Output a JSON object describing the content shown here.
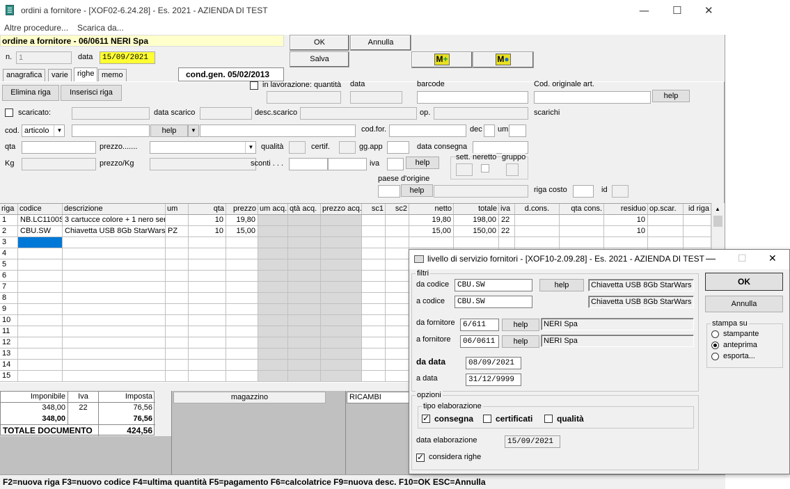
{
  "window": {
    "title": "ordini a fornitore - [XOF02-6.24.28] - Es. 2021 - AZIENDA DI TEST"
  },
  "menu": [
    "Altre procedure...",
    "Scarica da..."
  ],
  "header": {
    "ordine_label": "ordine a fornitore - 06/0611 NERI Spa",
    "n_label": "n.",
    "n_value": "1",
    "data_label": "data",
    "data_value": "15/09/2021",
    "cond_gen": "cond.gen. 05/02/2013"
  },
  "buttons": {
    "ok": "OK",
    "annulla": "Annulla",
    "salva": "Salva",
    "elimina_riga": "Elimina riga",
    "inserisci_riga": "Inserisci riga",
    "help": "help"
  },
  "tabs": [
    "anagrafica",
    "varie",
    "righe",
    "memo"
  ],
  "form": {
    "in_lavorazione": "in lavorazione: quantità",
    "data": "data",
    "barcode": "barcode",
    "cod_originale": "Cod. originale art.",
    "scaricato": "scaricato:",
    "data_scarico": "data scarico",
    "desc_scarico": "desc.scarico",
    "op": "op.",
    "scarichi": "scarichi",
    "cod": "cod.",
    "cod_value": "articolo",
    "cod_for": "cod.for.",
    "dec": "dec",
    "um": "um",
    "qta": "qta",
    "prezzo": "prezzo.......",
    "qualita": "qualità",
    "certif": "certif.",
    "gg_app": "gg.app",
    "data_consegna": "data consegna",
    "kg": "Kg",
    "prezzo_kg": "prezzo/Kg",
    "sconti": "sconti . . .",
    "iva": "iva",
    "sett": "sett.",
    "neretto": "neretto",
    "gruppo": "gruppo",
    "paese_origine": "paese d'origine",
    "riga_costo": "riga costo",
    "id": "id"
  },
  "grid": {
    "headers": [
      "riga",
      "codice",
      "descrizione",
      "um",
      "qta",
      "prezzo",
      "um acq.",
      "qtà acq.",
      "prezzo acq.",
      "sc1",
      "sc2",
      "netto",
      "totale",
      "iva",
      "d.cons.",
      "qta cons.",
      "residuo",
      "op.scar.",
      "id riga"
    ],
    "rows": [
      {
        "riga": "1",
        "codice": "NB.LC1100S",
        "descrizione": "3 cartucce colore + 1 nero ser",
        "um": "",
        "qta": "10",
        "prezzo": "19,80",
        "netto": "19,80",
        "totale": "198,00",
        "iva": "22",
        "residuo": "10"
      },
      {
        "riga": "2",
        "codice": "CBU.SW",
        "descrizione": "Chiavetta USB 8Gb StarWars",
        "um": "PZ",
        "qta": "10",
        "prezzo": "15,00",
        "netto": "15,00",
        "totale": "150,00",
        "iva": "22",
        "residuo": "10"
      }
    ],
    "empty_rows": [
      "3",
      "4",
      "5",
      "6",
      "7",
      "8",
      "9",
      "10",
      "11",
      "12",
      "13",
      "14",
      "15"
    ]
  },
  "totals": {
    "h_imponibile": "Imponibile",
    "h_iva": "Iva",
    "h_imposta": "Imposta",
    "r1_imp": "348,00",
    "r1_iva": "22",
    "r1_imposta": "76,56",
    "r2_imp": "348,00",
    "r2_imposta": "76,56",
    "totale_label": "TOTALE DOCUMENTO",
    "totale_value": "424,56"
  },
  "panels": {
    "magazzino": "magazzino",
    "ricambi": "RICAMBI"
  },
  "status": "F2=nuova riga  F3=nuovo codice  F4=ultima quantità  F5=pagamento  F6=calcolatrice  F9=nuova desc.  F10=OK  ESC=Annulla",
  "dialog": {
    "title": "livello di servizio fornitori - [XOF10-2.09.28] - Es. 2021 - AZIENDA DI TEST",
    "filtri": "filtri",
    "da_codice": "da codice",
    "da_codice_value": "CBU.SW",
    "da_codice_desc": "Chiavetta USB 8Gb StarWars",
    "a_codice": "a codice",
    "a_codice_value": "CBU.SW",
    "a_codice_desc": "Chiavetta USB 8Gb StarWars",
    "da_fornitore": "da fornitore",
    "da_fornitore_value": "6/611",
    "da_fornitore_desc": "NERI Spa",
    "a_fornitore": "a fornitore",
    "a_fornitore_value": "06/0611",
    "a_fornitore_desc": "NERI Spa",
    "da_data": "da data",
    "da_data_value": "08/09/2021",
    "a_data": "a data",
    "a_data_value": "31/12/9999",
    "opzioni": "opzioni",
    "tipo_elaborazione": "tipo elaborazione",
    "consegna": "consegna",
    "certificati": "certificati",
    "qualita": "qualità",
    "data_elaborazione": "data elaborazione",
    "data_elaborazione_value": "15/09/2021",
    "considera_righe": "considera righe",
    "ok": "OK",
    "annulla": "Annulla",
    "help": "help",
    "stampa_su": "stampa su",
    "stampante": "stampante",
    "anteprima": "anteprima",
    "esporta": "esporta..."
  },
  "colors": {
    "highlight_yellow": "#ffff33",
    "selected_cell": "#0078d7",
    "panel_gray": "#c0c0c0"
  }
}
